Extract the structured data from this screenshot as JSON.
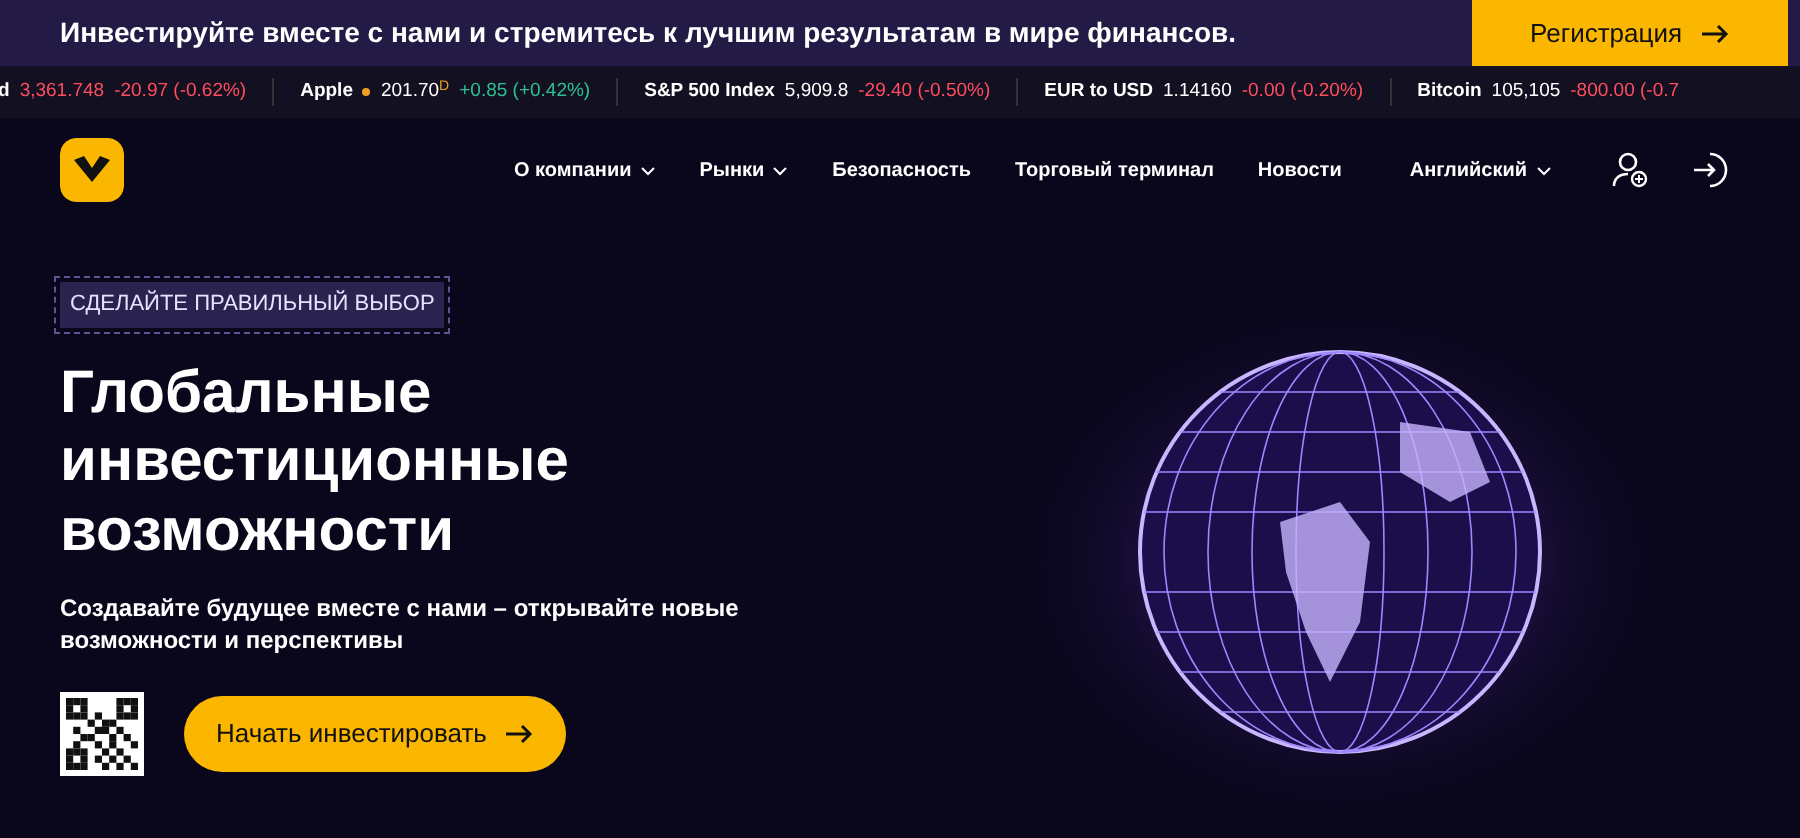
{
  "banner": {
    "text": "Инвестируйте вместе с нами и стремитесь к лучшим результатам в мире финансов.",
    "button": "Регистрация"
  },
  "ticker": [
    {
      "name": "d",
      "price": "3,361.748",
      "price_highlighted": true,
      "change": "-20.97 (-0.62%)",
      "rising": false,
      "dot": false
    },
    {
      "name": "Apple",
      "price": "201.70",
      "note": "D",
      "change": "+0.85 (+0.42%)",
      "rising": true,
      "price_highlighted": false,
      "dot": true
    },
    {
      "name": "S&P 500 Index",
      "price": "5,909.8",
      "change": "-29.40 (-0.50%)",
      "rising": false,
      "price_highlighted": false,
      "dot": false
    },
    {
      "name": "EUR to USD",
      "price": "1.14160",
      "change": "-0.00 (-0.20%)",
      "rising": false,
      "price_highlighted": false,
      "dot": false
    },
    {
      "name": "Bitcoin",
      "price": "105,105",
      "change": "-800.00 (-0.7",
      "rising": false,
      "price_highlighted": false,
      "dot": false
    }
  ],
  "nav": {
    "items": [
      {
        "label": "О компании",
        "dropdown": true
      },
      {
        "label": "Рынки",
        "dropdown": true
      },
      {
        "label": "Безопасность",
        "dropdown": false
      },
      {
        "label": "Торговый терминал",
        "dropdown": false
      },
      {
        "label": "Новости",
        "dropdown": false
      }
    ],
    "language": "Английский"
  },
  "hero": {
    "tag": "СДЕЛАЙТЕ ПРАВИЛЬНЫЙ ВЫБОР",
    "title_lines": [
      "Глобальные",
      "инвестиционные",
      "возможности"
    ],
    "subtitle": "Создавайте будущее вместе с нами – открывайте новые возможности и перспективы",
    "button": "Начать инвестировать"
  }
}
